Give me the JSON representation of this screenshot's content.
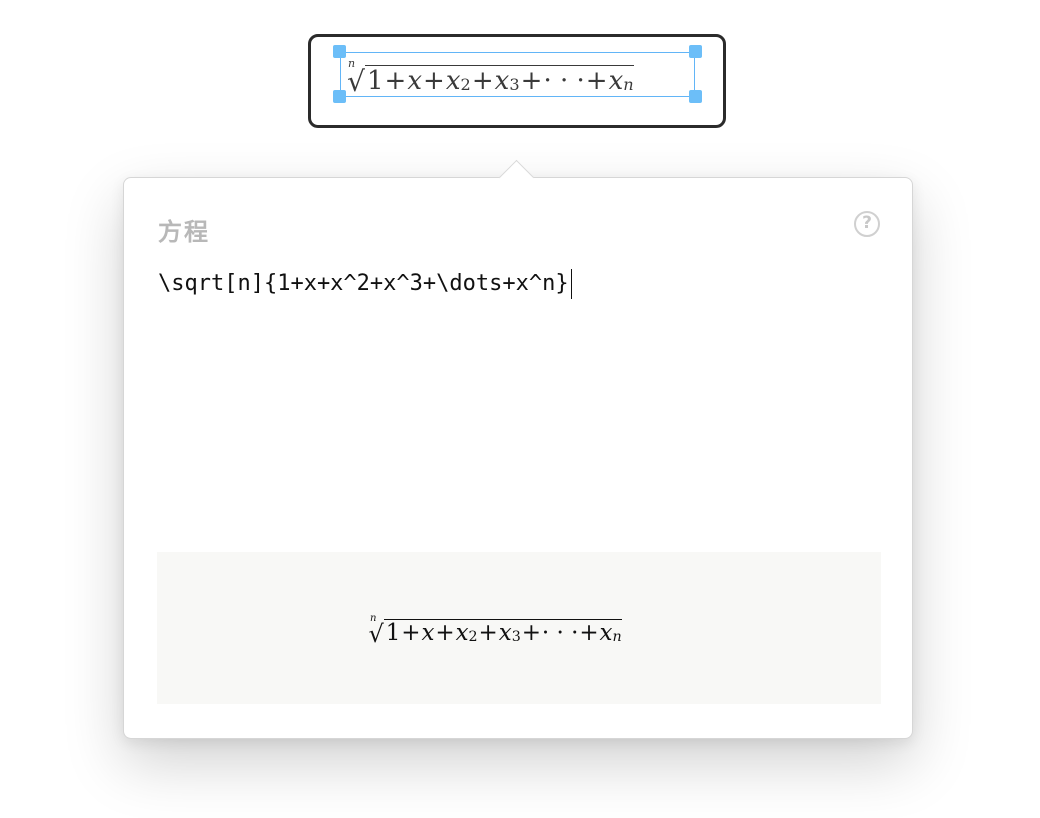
{
  "canvas": {
    "equation": {
      "root_index": "n",
      "radical": "√",
      "terms": [
        {
          "kind": "num",
          "text": "1"
        },
        {
          "kind": "op",
          "text": "+"
        },
        {
          "kind": "var",
          "text": "x"
        },
        {
          "kind": "op",
          "text": "+"
        },
        {
          "kind": "var",
          "text": "x",
          "sup": "2"
        },
        {
          "kind": "op",
          "text": "+"
        },
        {
          "kind": "var",
          "text": "x",
          "sup": "3"
        },
        {
          "kind": "op",
          "text": "+"
        },
        {
          "kind": "dots",
          "text": "· · ·"
        },
        {
          "kind": "op",
          "text": "+"
        },
        {
          "kind": "var",
          "text": "x",
          "sup": "n"
        }
      ]
    },
    "selection_color": "#62b5f7"
  },
  "panel": {
    "title": "方程",
    "help_icon": "question-circle-icon",
    "help_glyph": "?",
    "latex_source": "\\sqrt[n]{1+x+x^2+x^3+\\dots+x^n}"
  }
}
